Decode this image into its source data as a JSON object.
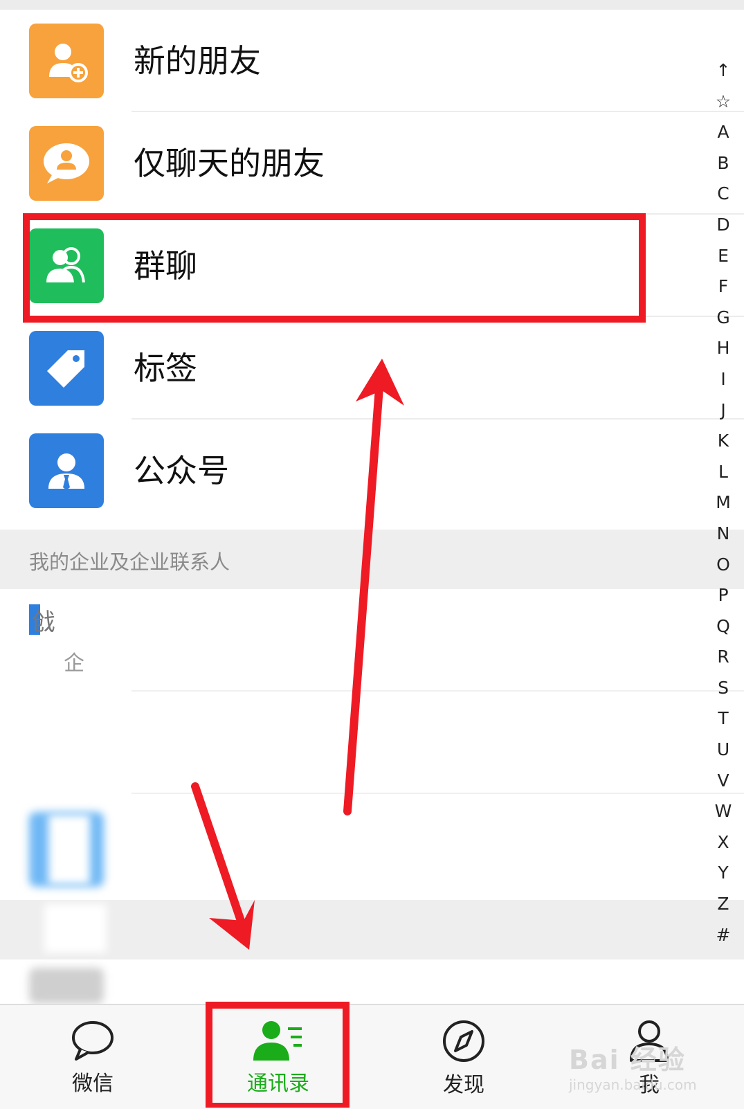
{
  "menu": {
    "items": [
      {
        "label": "新的朋友",
        "icon": "add-friend-icon",
        "color": "#f7a23c"
      },
      {
        "label": "仅聊天的朋友",
        "icon": "chat-friend-icon",
        "color": "#f7a23c"
      },
      {
        "label": "群聊",
        "icon": "group-chat-icon",
        "color": "#1fbd5b"
      },
      {
        "label": "标签",
        "icon": "tag-icon",
        "color": "#2f7fdf"
      },
      {
        "label": "公众号",
        "icon": "official-account-icon",
        "color": "#2f7fdf"
      }
    ]
  },
  "section": {
    "title": "我的企业及企业联系人"
  },
  "blurred_fragments": {
    "a": "戗",
    "b": "企"
  },
  "index_letters": [
    "↑",
    "☆",
    "A",
    "B",
    "C",
    "D",
    "E",
    "F",
    "G",
    "H",
    "I",
    "J",
    "K",
    "L",
    "M",
    "N",
    "O",
    "P",
    "Q",
    "R",
    "S",
    "T",
    "U",
    "V",
    "W",
    "X",
    "Y",
    "Z",
    "#"
  ],
  "tabbar": {
    "tabs": [
      {
        "label": "微信",
        "icon": "chat-bubble-icon"
      },
      {
        "label": "通讯录",
        "icon": "contacts-icon",
        "active": true
      },
      {
        "label": "发现",
        "icon": "compass-icon"
      },
      {
        "label": "我",
        "icon": "person-icon"
      }
    ]
  },
  "watermark": {
    "logo": "Bai 经验",
    "url": "jingyan.baidu.com"
  },
  "colors": {
    "accent": "#1aad19",
    "annotation": "#ee1b24"
  }
}
